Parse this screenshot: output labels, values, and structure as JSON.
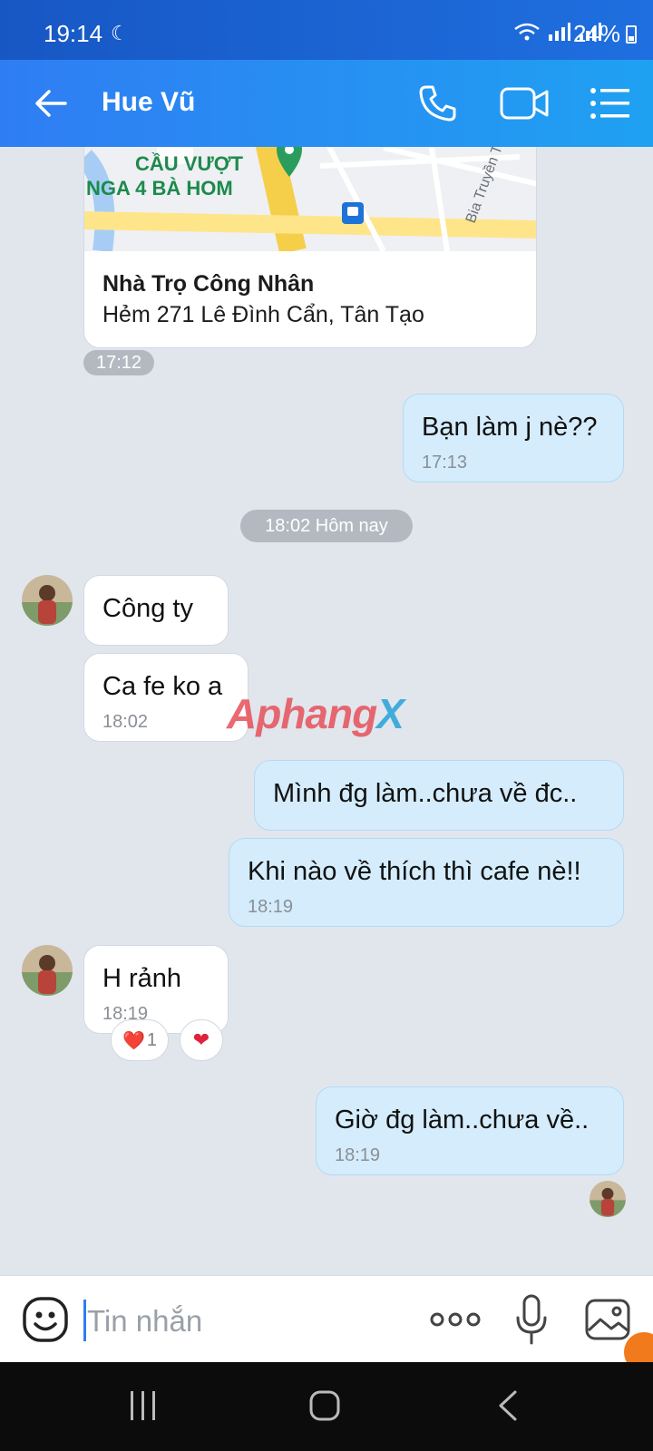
{
  "status_bar": {
    "time": "19:14",
    "battery": "24%"
  },
  "header": {
    "contact_name": "Hue Vũ"
  },
  "location_card": {
    "map_label_line1": "CẦU VƯỢT",
    "map_label_line2": "NGA 4 BÀ HOM",
    "street_label": "Bia Truyền T",
    "name": "Nhà Trọ Công Nhân",
    "address": "Hẻm 271 Lê Đình Cẩn, Tân Tạo",
    "time": "17:12"
  },
  "messages": [
    {
      "direction": "out",
      "text": "Bạn làm j nè??",
      "time": "17:13"
    },
    {
      "direction": "in",
      "text": "Công ty",
      "time": ""
    },
    {
      "direction": "in",
      "text": "Ca fe ko a",
      "time": "18:02"
    },
    {
      "direction": "out",
      "text": "Mình đg làm..chưa về đc..",
      "time": ""
    },
    {
      "direction": "out",
      "text": "Khi nào về thích thì cafe nè!!",
      "time": "18:19"
    },
    {
      "direction": "in",
      "text": "H rảnh",
      "time": "18:19",
      "reaction": "❤️",
      "reaction_count": "1"
    },
    {
      "direction": "out",
      "text": "Giờ đg làm..chưa về..",
      "time": "18:19"
    }
  ],
  "date_separator": "18:02 Hôm nay",
  "watermark": {
    "part1": "Aphang",
    "part2": "X"
  },
  "input": {
    "placeholder": "Tin nhắn"
  },
  "icons": {
    "back": "back-arrow-icon",
    "call": "phone-icon",
    "video": "video-camera-icon",
    "menu": "menu-icon",
    "emoji": "emoji-icon",
    "more": "more-icon",
    "mic": "microphone-icon",
    "gallery": "image-icon"
  },
  "colors": {
    "header": "#2f7df3",
    "outgoing_bubble": "#d4ecfb",
    "background": "#e1e6ed"
  }
}
